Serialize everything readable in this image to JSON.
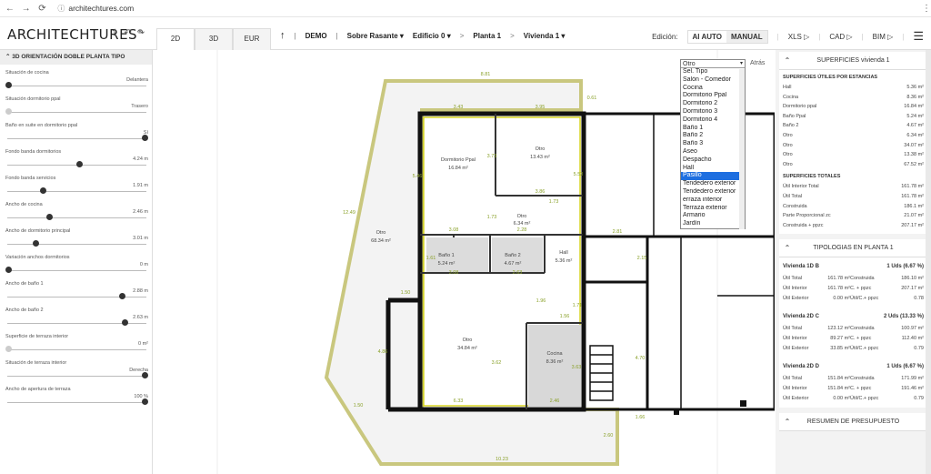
{
  "browser": {
    "url": "architechtures.com",
    "back": "←",
    "forward": "→",
    "reload": "⟳",
    "lock": "ⓘ"
  },
  "app": {
    "logo": "ARCHITECHTURES",
    "logo_mark": "®",
    "view_tabs": [
      "2D",
      "3D",
      "EUR"
    ],
    "breadcrumbs": [
      "DEMO",
      "Sobre Rasante ▾",
      "Edificio 0 ▾",
      "Planta 1",
      "Vivienda 1 ▾"
    ],
    "edicion_label": "Edición:",
    "mode_ai": "AI AUTO",
    "mode_manual": "MANUAL",
    "export_xls": "XLS ▷",
    "export_cad": "CAD ▷",
    "export_bim": "BIM ▷"
  },
  "left_panel": {
    "title": "3D ORIENTACIÓN DOBLE PLANTA TIPO",
    "sliders": [
      {
        "label": "Situación de cocina",
        "value": "Delantera",
        "pos": 0.0,
        "enabled": true
      },
      {
        "label": "Situación dormitorio ppal",
        "value": "Trasero",
        "pos": 0.0,
        "enabled": false
      },
      {
        "label": "Baño en suite en dormitorio ppal",
        "value": "Sí",
        "pos": 1.0,
        "enabled": true
      },
      {
        "label": "Fondo banda dormitorios",
        "value": "4.24 m",
        "pos": 0.52,
        "enabled": true
      },
      {
        "label": "Fondo banda servicios",
        "value": "1.91 m",
        "pos": 0.25,
        "enabled": true
      },
      {
        "label": "Ancho de cocina",
        "value": "2.46 m",
        "pos": 0.3,
        "enabled": true
      },
      {
        "label": "Ancho de dormitorio principal",
        "value": "3.01 m",
        "pos": 0.2,
        "enabled": true
      },
      {
        "label": "Variación anchos dormitorios",
        "value": "0 m",
        "pos": 0.0,
        "enabled": true
      },
      {
        "label": "Ancho de baño 1",
        "value": "2.88 m",
        "pos": 0.83,
        "enabled": true
      },
      {
        "label": "Ancho de baño 2",
        "value": "2.63 m",
        "pos": 0.85,
        "enabled": true
      },
      {
        "label": "Superficie de terraza interior",
        "value": "0 m²",
        "pos": 0.0,
        "enabled": false
      },
      {
        "label": "Situación de terraza interior",
        "value": "Derecha",
        "pos": 1.0,
        "enabled": true
      },
      {
        "label": "Ancho de apertura de terraza",
        "value": "100 %",
        "pos": 1.0,
        "enabled": true
      }
    ]
  },
  "plan": {
    "rooms": [
      {
        "name": "Dormitorio Ppal",
        "area": "16.84 m²"
      },
      {
        "name": "Otro",
        "area": "13.43 m²"
      },
      {
        "name": "Otro",
        "area": "6.34 m²"
      },
      {
        "name": "Otro",
        "area": "68.34 m²"
      },
      {
        "name": "Baño 1",
        "area": "5.24 m²"
      },
      {
        "name": "Baño 2",
        "area": "4.67 m²"
      },
      {
        "name": "Hall",
        "area": "5.36 m²"
      },
      {
        "name": "Otro",
        "area": "34.84 m²"
      },
      {
        "name": "Cocina",
        "area": "8.36 m²"
      }
    ],
    "dims": [
      "8.81",
      "3.43",
      "3.95",
      "3.73",
      "5.53",
      "3.86",
      "2.28",
      "1.73",
      "3.08",
      "2.81",
      "2.63",
      "3.08",
      "1.56",
      "1.71",
      "1.50",
      "1.96",
      "3.62",
      "3.63",
      "2.46",
      "6.33",
      "4.86",
      "12.49",
      "5.46",
      "1.61",
      "10.23",
      "2.60",
      "1.66",
      "4.70",
      "2.15",
      "0.61",
      "1.50",
      "1.73"
    ]
  },
  "dropdown": {
    "selected": "Otro",
    "caret": "▾",
    "highlighted_index": 15,
    "options": [
      "Sel. Tipo",
      "Salón - Comedor",
      "Cocina",
      "Dormitorio Ppal",
      "Dormitorio 2",
      "Dormitorio 3",
      "Dormitorio 4",
      "Baño 1",
      "Baño 2",
      "Baño 3",
      "Aseo",
      "Despacho",
      "Hall",
      "Pasillo",
      "Tendedero exterior",
      "Tendedero exterior",
      "erraza interior",
      "Terraza exterior",
      "Armario",
      "Jardín"
    ],
    "back_label": "Atrás"
  },
  "right_panel": {
    "superficies_title": "SUPERFICIES vivienda 1",
    "utiles_title": "SUPERFICIES ÚTILES POR ESTANCIAS",
    "utiles": [
      {
        "k": "Hall",
        "v": "5.36 m²"
      },
      {
        "k": "Cocina",
        "v": "8.36 m²"
      },
      {
        "k": "Dormitorio ppal",
        "v": "16.84 m²"
      },
      {
        "k": "Baño Ppal",
        "v": "5.24 m²"
      },
      {
        "k": "Baño 2",
        "v": "4.67 m²"
      },
      {
        "k": "Otro",
        "v": "6.34 m²"
      },
      {
        "k": "Otro",
        "v": "34.07 m²"
      },
      {
        "k": "Otro",
        "v": "13.38 m²"
      },
      {
        "k": "Otro",
        "v": "67.52 m²"
      }
    ],
    "totales_title": "SUPERFICIES TOTALES",
    "totales": [
      {
        "k": "Útil Interior Total",
        "v": "161.78 m²"
      },
      {
        "k": "Útil Total",
        "v": "161.78 m²"
      },
      {
        "k": "Construida",
        "v": "186.1 m²"
      },
      {
        "k": "Parte Proporcional zc",
        "v": "21.07 m²"
      },
      {
        "k": "Construida + ppzc",
        "v": "207.17 m²"
      }
    ],
    "tipologias_title": "TIPOLOGIAS EN PLANTA 1",
    "tipologias": [
      {
        "name": "Vivienda 1D B",
        "count": "1 Uds (6.67 %)",
        "rows": [
          [
            "Útil Total",
            "161.78 m²",
            "Construida",
            "186.10 m²"
          ],
          [
            "Útil Interior",
            "161.78 m²",
            "C. + ppzc",
            "207.17 m²"
          ],
          [
            "Útil Exterior",
            "0.00 m²",
            "Útil/C.+ ppzc",
            "0.78"
          ]
        ]
      },
      {
        "name": "Vivienda 2D C",
        "count": "2 Uds (13.33 %)",
        "rows": [
          [
            "Útil Total",
            "123.12 m²",
            "Construida",
            "100.97 m²"
          ],
          [
            "Útil Interior",
            "89.27 m²",
            "C. + ppzc",
            "112.40 m²"
          ],
          [
            "Útil Exterior",
            "33.85 m²",
            "Útil/C.+ ppzc",
            "0.79"
          ]
        ]
      },
      {
        "name": "Vivienda 2D D",
        "count": "1 Uds (6.67 %)",
        "rows": [
          [
            "Útil Total",
            "151.84 m²",
            "Construida",
            "171.99 m²"
          ],
          [
            "Útil Interior",
            "151.84 m²",
            "C. + ppzc",
            "191.46 m²"
          ],
          [
            "Útil Exterior",
            "0.00 m²",
            "Útil/C.+ ppzc",
            "0.79"
          ]
        ]
      }
    ],
    "presupuesto_title": "RESUMEN DE PRESUPUESTO"
  }
}
